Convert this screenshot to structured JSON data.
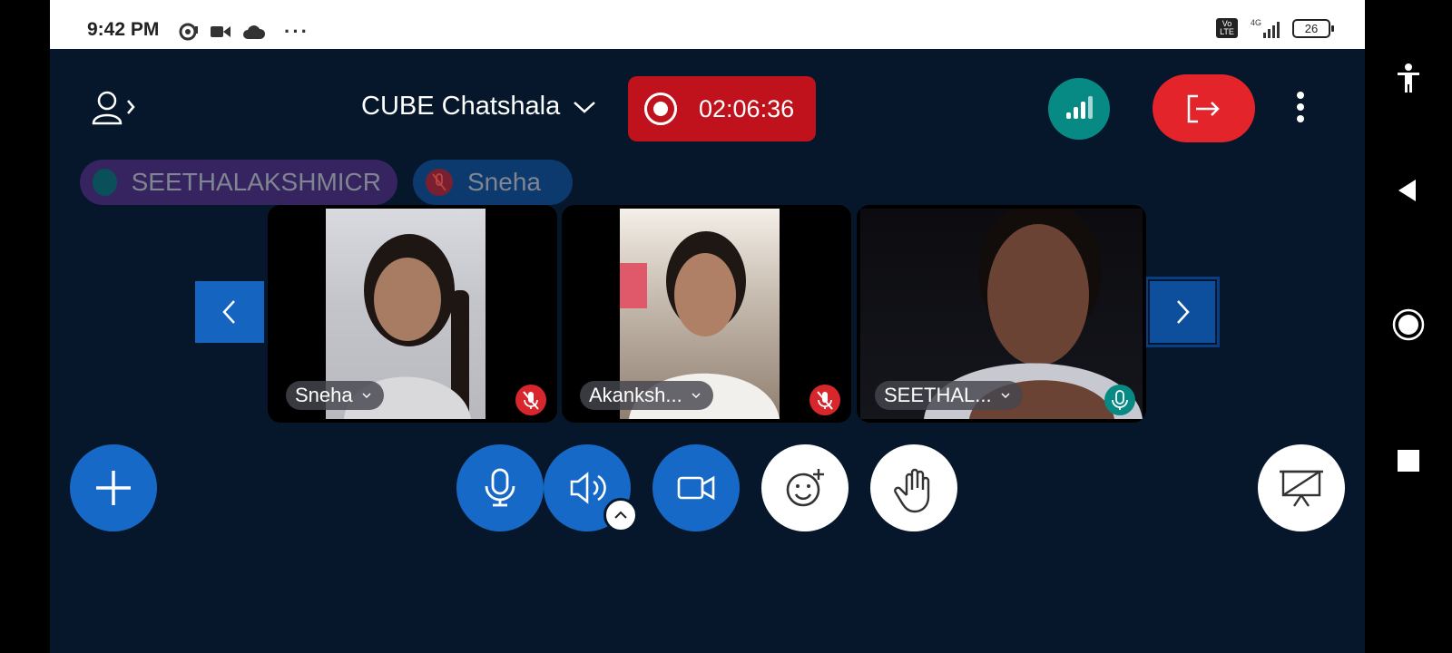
{
  "status_bar": {
    "time": "9:42 PM",
    "network": "4G",
    "battery": "26",
    "more": "···"
  },
  "header": {
    "meeting_title": "CUBE Chatshala",
    "recording_time": "02:06:36"
  },
  "talkers": [
    {
      "name": "SEETHALAKSHMICR"
    },
    {
      "name": "Sneha"
    }
  ],
  "participants": [
    {
      "name": "Sneha",
      "mic": "muted"
    },
    {
      "name": "Akanksh...",
      "mic": "muted"
    },
    {
      "name": "SEETHAL...",
      "mic": "on"
    }
  ],
  "colors": {
    "background": "#06172b",
    "primary_blue": "#1769c7",
    "record_red": "#c0121c",
    "leave_red": "#e3242b",
    "connection_teal": "#078a84",
    "mute_red": "#d8262d"
  },
  "icons": {
    "user_list": "user-icon",
    "connection": "signal-bars-icon",
    "leave": "exit-icon",
    "mic": "microphone-icon",
    "audio": "speaker-icon",
    "camera": "camera-icon",
    "reactions": "emoji-add-icon",
    "raise_hand": "hand-icon",
    "presentation": "presentation-icon"
  }
}
